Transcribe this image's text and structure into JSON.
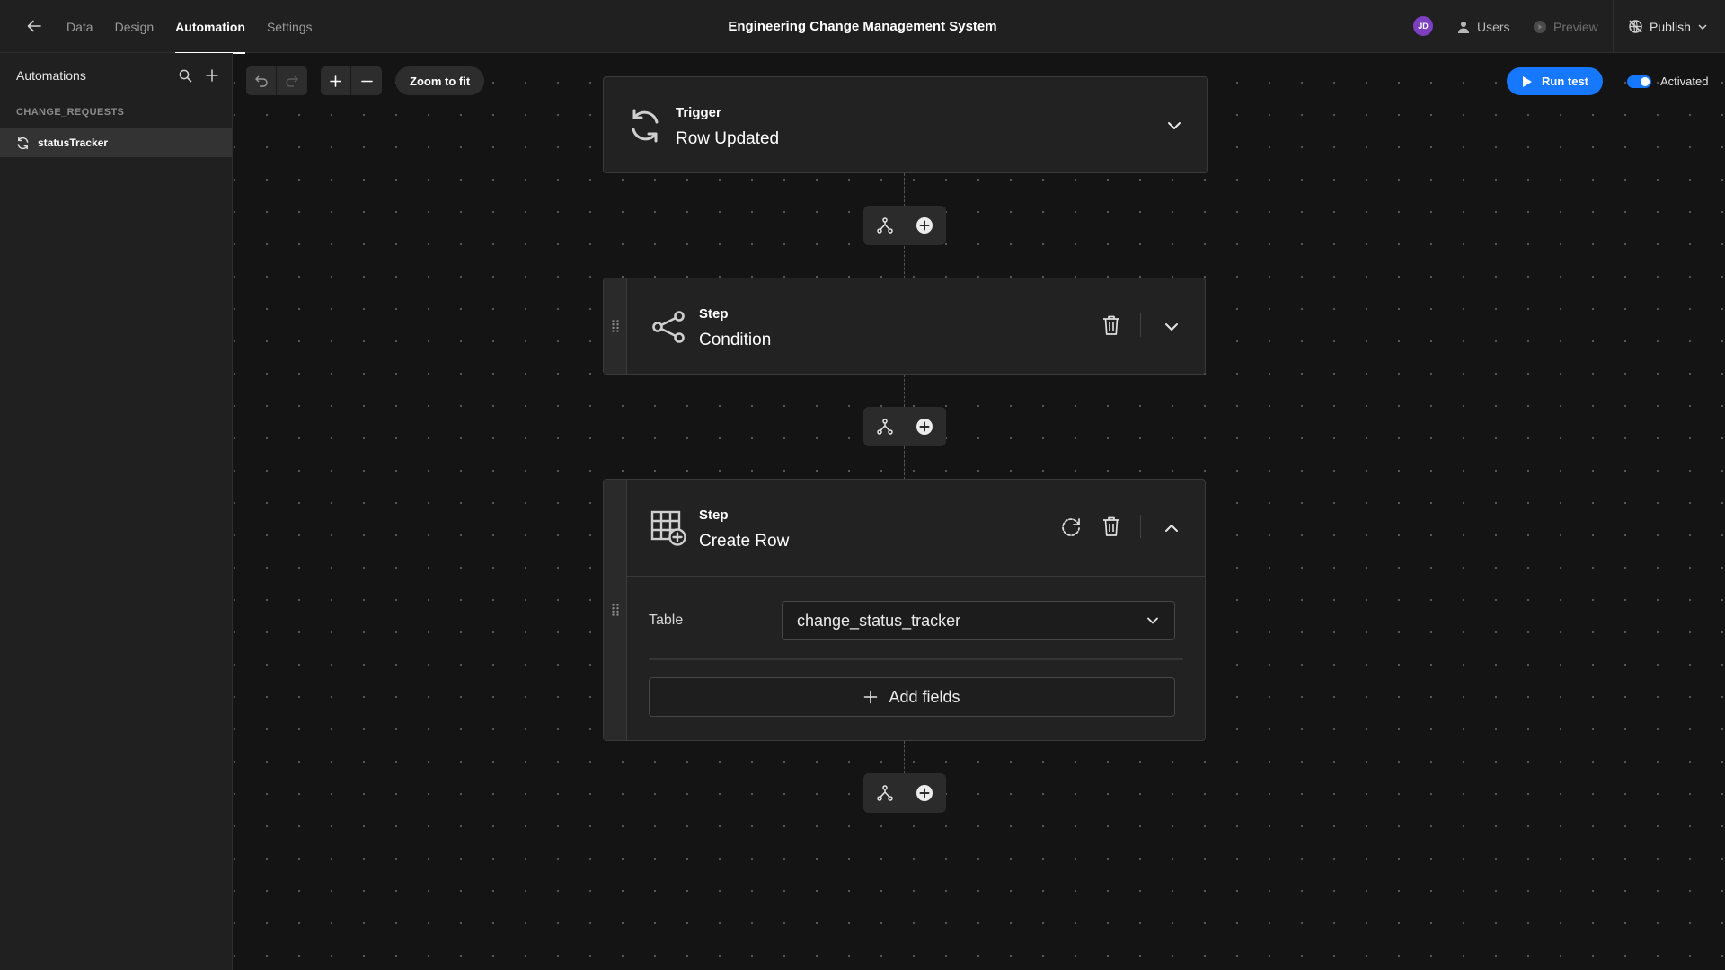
{
  "topbar": {
    "tabs": [
      {
        "label": "Data",
        "active": false
      },
      {
        "label": "Design",
        "active": false
      },
      {
        "label": "Automation",
        "active": true
      },
      {
        "label": "Settings",
        "active": false
      }
    ],
    "app_title": "Engineering Change Management System",
    "avatar_initials": "JD",
    "users_label": "Users",
    "preview_label": "Preview",
    "publish_label": "Publish"
  },
  "sidebar": {
    "title": "Automations",
    "group": "CHANGE_REQUESTS",
    "items": [
      {
        "label": "statusTracker",
        "selected": true
      }
    ]
  },
  "canvas": {
    "zoom_to_fit_label": "Zoom to fit",
    "run_test_label": "Run test",
    "activated_label": "Activated",
    "activated": true,
    "trigger": {
      "label": "Trigger",
      "name": "Row Updated"
    },
    "steps": [
      {
        "label": "Step",
        "name": "Condition",
        "expanded": false
      },
      {
        "label": "Step",
        "name": "Create Row",
        "expanded": true,
        "table_label": "Table",
        "table_value": "change_status_tracker",
        "add_fields_label": "Add fields"
      }
    ]
  },
  "colors": {
    "accent": "#1677ff",
    "avatar": "#7b3fbf",
    "background": "#141414",
    "panel": "#202020"
  }
}
